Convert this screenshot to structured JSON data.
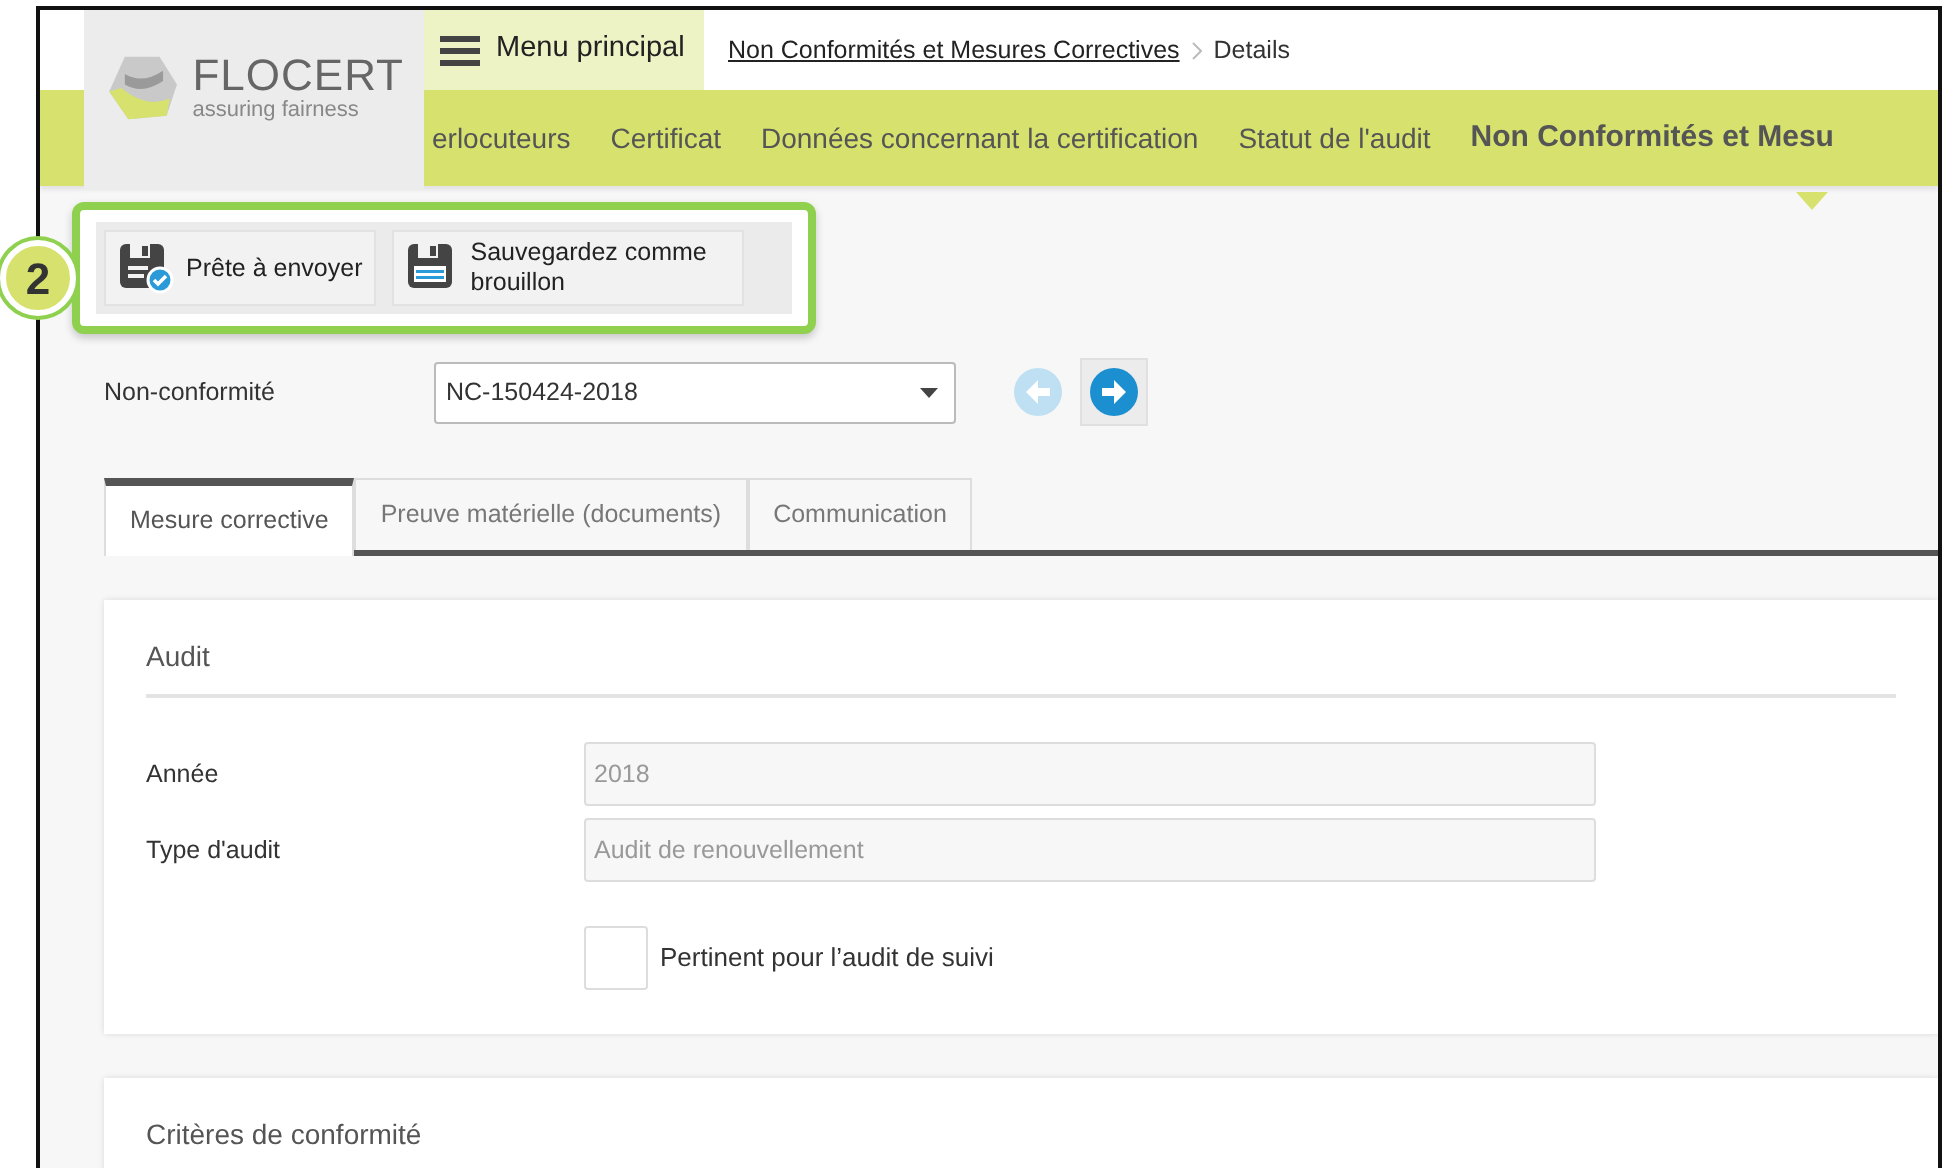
{
  "logo": {
    "name": "FLOCERT",
    "tagline": "assuring fairness"
  },
  "menu_button": "Menu principal",
  "breadcrumb": [
    {
      "label": "Non Conformités et Mesures Correctives",
      "kind": "link"
    },
    {
      "label": "Details",
      "kind": "current"
    }
  ],
  "nav_tabs": [
    {
      "label": "erlocuteurs",
      "selected": false
    },
    {
      "label": "Certificat",
      "selected": false
    },
    {
      "label": "Données concernant la certification",
      "selected": false
    },
    {
      "label": "Statut de l'audit",
      "selected": false
    },
    {
      "label": "Non Conformités et Mesu",
      "selected": true
    }
  ],
  "annotation": {
    "number": "2"
  },
  "toolbar": [
    {
      "label": "Prête à envoyer",
      "kind": "ready"
    },
    {
      "label": "Sauvegardez comme brouillon",
      "kind": "draft"
    }
  ],
  "nonconformity": {
    "label": "Non-conformité",
    "value": "NC-150424-2018",
    "previous": {
      "disabled": true
    },
    "next": {
      "disabled": false
    }
  },
  "tabs": [
    {
      "label": "Mesure corrective",
      "selected": true
    },
    {
      "label": "Preuve matérielle (documents)",
      "selected": false
    },
    {
      "label": "Communication",
      "selected": false
    }
  ],
  "sections": [
    {
      "title": "Audit",
      "fields": [
        {
          "label": "Année",
          "value": "2018"
        },
        {
          "label": "Type d'audit",
          "value": "Audit de renouvellement"
        }
      ],
      "checkbox": {
        "label": "Pertinent pour l’audit de suivi",
        "checked": false
      }
    },
    {
      "title": "Critères de conformité"
    }
  ]
}
